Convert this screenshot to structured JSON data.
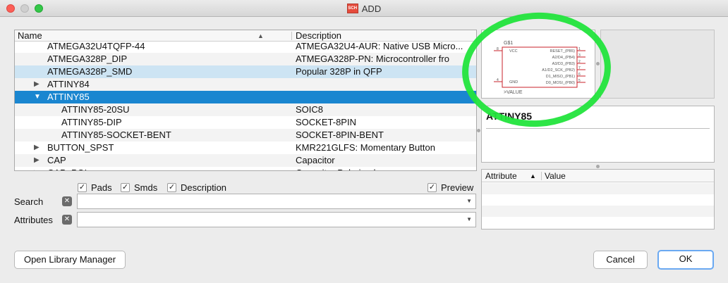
{
  "window": {
    "title": "ADD",
    "title_icon_text": "SCH"
  },
  "list": {
    "col_name": "Name",
    "col_desc": "Description",
    "rows": [
      {
        "name": "ATMEGA32U4TQFP-44",
        "desc": "ATMEGA32U4-AUR: Native USB Micro...",
        "indent": 1,
        "expander": ""
      },
      {
        "name": "ATMEGA328P_DIP",
        "desc": "ATMEGA328P-PN: Microcontroller fro",
        "indent": 1,
        "expander": ""
      },
      {
        "name": "ATMEGA328P_SMD",
        "desc": "Popular 328P in QFP",
        "indent": 1,
        "expander": ""
      },
      {
        "name": "ATTINY84",
        "desc": "",
        "indent": 1,
        "expander": "▶"
      },
      {
        "name": "ATTINY85",
        "desc": "",
        "indent": 1,
        "expander": "▼"
      },
      {
        "name": "ATTINY85-20SU",
        "desc": "SOIC8",
        "indent": 2,
        "expander": ""
      },
      {
        "name": "ATTINY85-DIP",
        "desc": "SOCKET-8PIN",
        "indent": 2,
        "expander": ""
      },
      {
        "name": "ATTINY85-SOCKET-BENT",
        "desc": "SOCKET-8PIN-BENT",
        "indent": 2,
        "expander": ""
      },
      {
        "name": "BUTTON_SPST",
        "desc": "KMR221GLFS: Momentary Button",
        "indent": 1,
        "expander": "▶"
      },
      {
        "name": "CAP",
        "desc": "Capacitor",
        "indent": 1,
        "expander": "▶"
      },
      {
        "name": "CAP_POL",
        "desc": "Capacitor Polarized",
        "indent": 1,
        "expander": "▶"
      }
    ]
  },
  "options": {
    "pads": "Pads",
    "smds": "Smds",
    "description": "Description",
    "preview": "Preview",
    "check": "✓"
  },
  "search": {
    "label": "Search",
    "value": ""
  },
  "attributes": {
    "label": "Attributes",
    "value": ""
  },
  "buttons": {
    "open_library_manager": "Open Library Manager",
    "cancel": "Cancel",
    "ok": "OK"
  },
  "preview": {
    "part_name": "G$1",
    "value_label": ">VALUE",
    "left_pins": [
      {
        "num": "8",
        "name": "VCC"
      },
      {
        "num": "4",
        "name": "GND"
      }
    ],
    "right_pins": [
      {
        "num": "1",
        "name": "RESET_(PB5)"
      },
      {
        "num": "3",
        "name": "A2/D4_(PB4)"
      },
      {
        "num": "2",
        "name": "A3/D3_(PB3)"
      },
      {
        "num": "7",
        "name": "A1/D2_SCK_(PB2)"
      },
      {
        "num": "6",
        "name": "D1_MISO_(PB1)"
      },
      {
        "num": "5",
        "name": "D0_MOSI_(PB0)"
      }
    ]
  },
  "info": {
    "title": "ATTINY85"
  },
  "attr_table": {
    "col_attribute": "Attribute",
    "col_value": "Value"
  },
  "colors": {
    "selection": "#1a86d0",
    "highlight": "#cde4f3",
    "annotation_ring": "#22e43c",
    "symbol_red": "#c8202a"
  }
}
